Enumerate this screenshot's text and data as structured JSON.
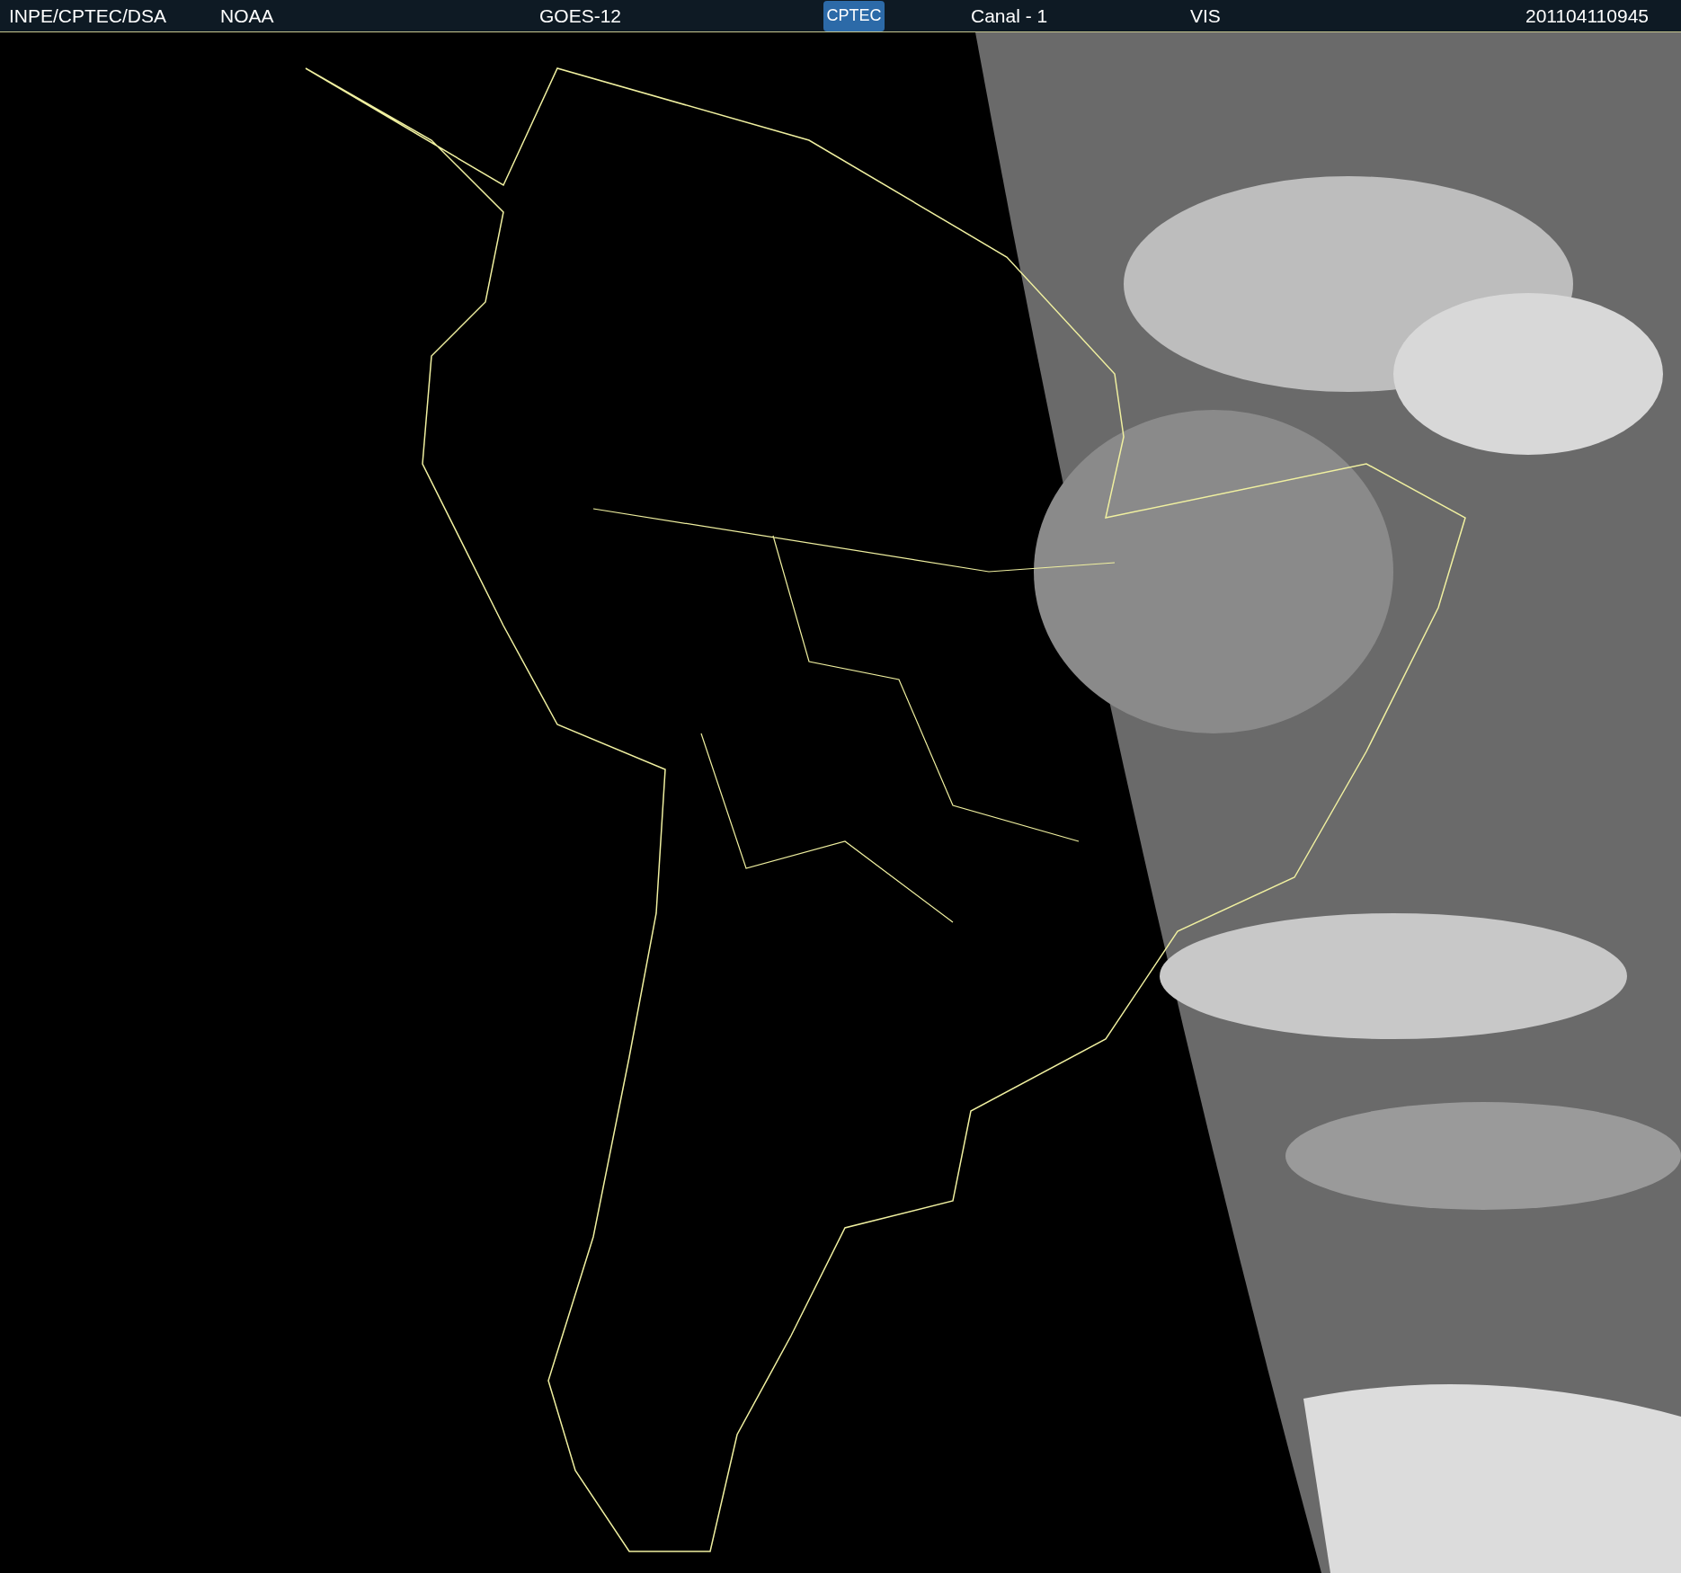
{
  "header": {
    "source": "INPE/CPTEC/DSA",
    "agency": "NOAA",
    "satellite": "GOES-12",
    "logo": "CPTEC",
    "channel": "Canal - 1",
    "band": "VIS",
    "timestamp": "201104110945"
  }
}
